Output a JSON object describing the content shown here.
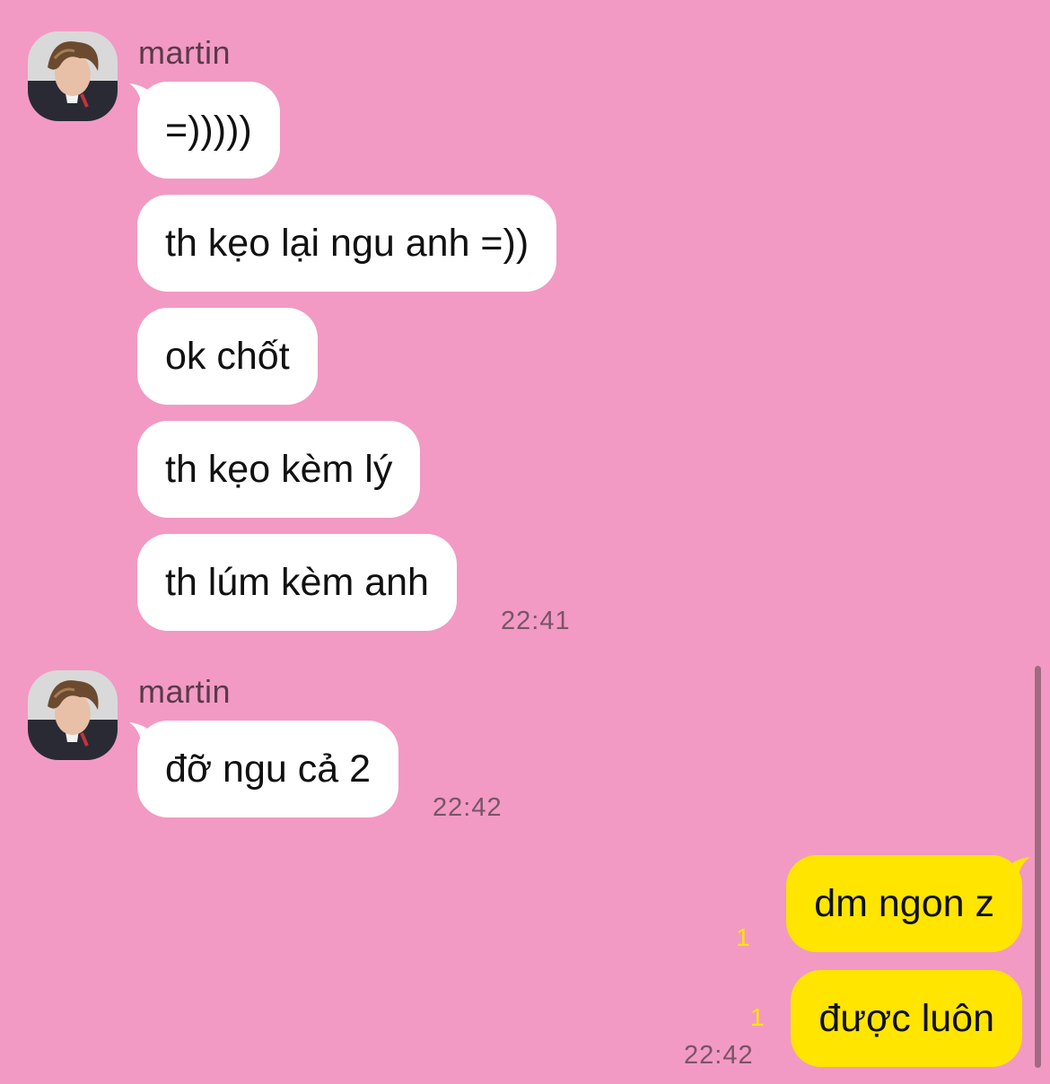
{
  "colors": {
    "background": "#F29AC3",
    "incoming_bubble": "#FFFFFF",
    "outgoing_bubble": "#FFE500",
    "time_text": "#7A5468",
    "unread_badge": "#FFE500"
  },
  "groups": [
    {
      "sender": "martin",
      "messages": [
        "=)))))",
        "th kẹo lại ngu anh =))",
        "ok chốt",
        "th kẹo kèm lý",
        "th lúm kèm anh"
      ],
      "time": "22:41"
    },
    {
      "sender": "martin",
      "messages": [
        "đỡ ngu cả 2"
      ],
      "time": "22:42"
    }
  ],
  "outgoing": {
    "messages": [
      {
        "text": "dm ngon z",
        "unread": "1"
      },
      {
        "text": "được luôn",
        "unread": "1"
      }
    ],
    "time": "22:42"
  }
}
